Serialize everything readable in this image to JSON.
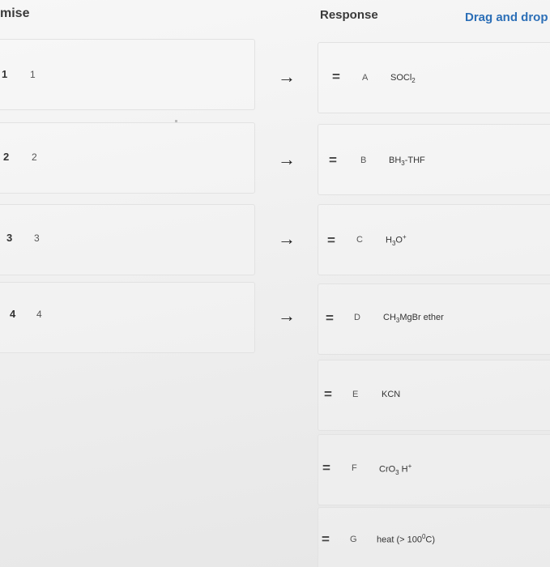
{
  "header": {
    "premise": "mise",
    "response": "Response",
    "drag_drop": "Drag and drop"
  },
  "premises": [
    {
      "num": "1",
      "label": "1"
    },
    {
      "num": "2",
      "label": "2"
    },
    {
      "num": "3",
      "label": "3"
    },
    {
      "num": "4",
      "label": "4"
    }
  ],
  "responses": [
    {
      "letter": "A",
      "parts": [
        "SOCl",
        "2",
        ""
      ]
    },
    {
      "letter": "B",
      "parts": [
        "BH",
        "3",
        "-THF"
      ]
    },
    {
      "letter": "C",
      "parts": [
        "H",
        "3",
        "O",
        "+"
      ]
    },
    {
      "letter": "D",
      "parts": [
        "CH",
        "3",
        "MgBr ether"
      ]
    },
    {
      "letter": "E",
      "text": "KCN"
    },
    {
      "letter": "F",
      "parts": [
        "CrO",
        "3",
        " H",
        "+"
      ]
    },
    {
      "letter": "G",
      "parts": [
        "heat (> 100",
        "0",
        "C)"
      ]
    }
  ],
  "arrow_glyph": "→",
  "handle_glyph": "="
}
